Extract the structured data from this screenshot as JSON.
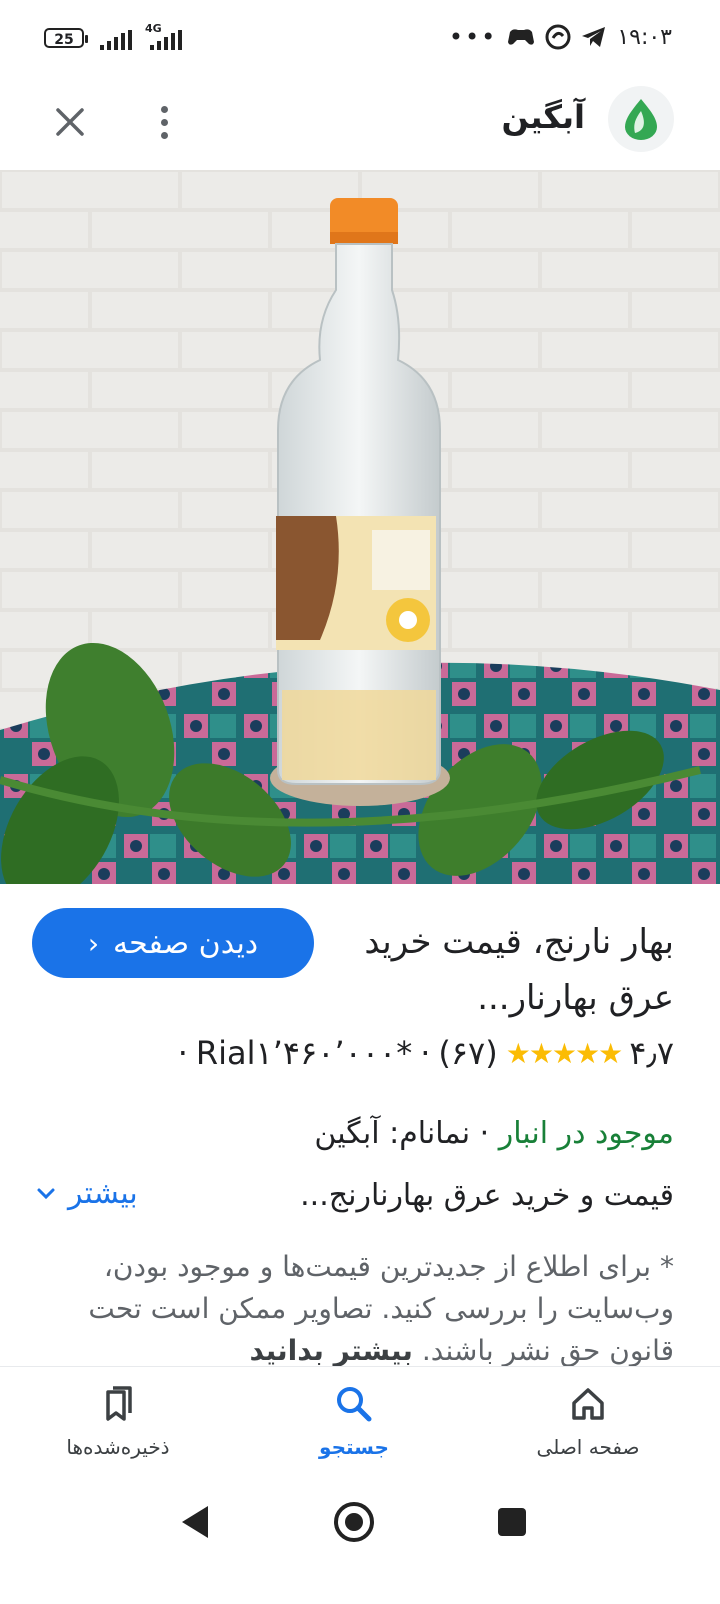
{
  "status_bar": {
    "battery": "25",
    "network": "4G",
    "dots": "•••",
    "time": "۱۹:۰۳"
  },
  "app_bar": {
    "title": "آبگین"
  },
  "product": {
    "visit_label": "دیدن صفحه",
    "title": "بهار نارنج، قیمت خرید عرق بهارنار...",
    "rating": "۴٫۷",
    "review_count": "(۶۷)",
    "price": "Rial۱٬۴۶۰٬۰۰۰*",
    "sep": "·",
    "stock": "موجود در انبار",
    "brand": "نمانام: آبگین",
    "description": "قیمت و خرید عرق بهارنارنج...",
    "more_label": "بیشتر",
    "disclaimer": "* برای اطلاع از جدیدترین قیمت‌ها و موجود بودن، وب‌سایت را بررسی کنید. تصاویر ممکن است تحت قانون حق نشر باشند.",
    "learn_more": "بیشتر بدانید"
  },
  "bottom_nav": {
    "items": [
      {
        "label": "صفحه اصلی",
        "icon": "home-icon"
      },
      {
        "label": "جستجو",
        "icon": "search-icon"
      },
      {
        "label": "ذخیره‌شده‌ها",
        "icon": "saved-icon"
      }
    ]
  },
  "colors": {
    "accent": "#1a73e8",
    "stock_green": "#188038",
    "star": "#fbbc04"
  }
}
